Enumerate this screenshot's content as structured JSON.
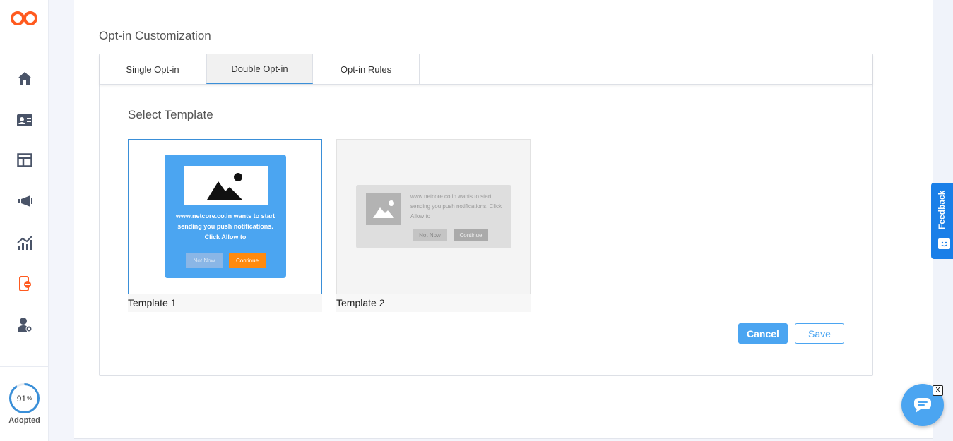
{
  "sidebar": {
    "items": [
      {
        "icon": "home-icon"
      },
      {
        "icon": "contact-card-icon"
      },
      {
        "icon": "layout-icon"
      },
      {
        "icon": "megaphone-icon"
      },
      {
        "icon": "analytics-icon"
      },
      {
        "icon": "mobile-push-icon"
      },
      {
        "icon": "user-settings-icon"
      }
    ],
    "adoption": {
      "value": "91",
      "unit": "%",
      "label": "Adopted",
      "fraction": 0.91
    }
  },
  "section": {
    "title": "Opt-in Customization"
  },
  "tabs": [
    {
      "label": "Single Opt-in",
      "active": false
    },
    {
      "label": "Double Opt-in",
      "active": true
    },
    {
      "label": "Opt-in Rules",
      "active": false
    }
  ],
  "templates": {
    "title": "Select Template",
    "items": [
      {
        "caption": "Template 1",
        "selected": true,
        "preview": {
          "message": "www.netcore.co.in wants to start sending you push notifications. Click Allow to",
          "not_now": "Not Now",
          "continue": "Continue"
        }
      },
      {
        "caption": "Template 2",
        "selected": false,
        "preview": {
          "message": "www.netcore.co.in wants to start sending you push notifications. Click Allow to",
          "not_now": "Not Now",
          "continue": "Continue"
        }
      }
    ]
  },
  "actions": {
    "cancel": "Cancel",
    "save": "Save"
  },
  "feedback": {
    "label": "Feedback"
  },
  "chat": {
    "close": "X"
  },
  "colors": {
    "accent": "#4ba5f1",
    "brand": "#ff5a1f",
    "feedback": "#1a7fe8",
    "continue": "#ff8a0d"
  }
}
